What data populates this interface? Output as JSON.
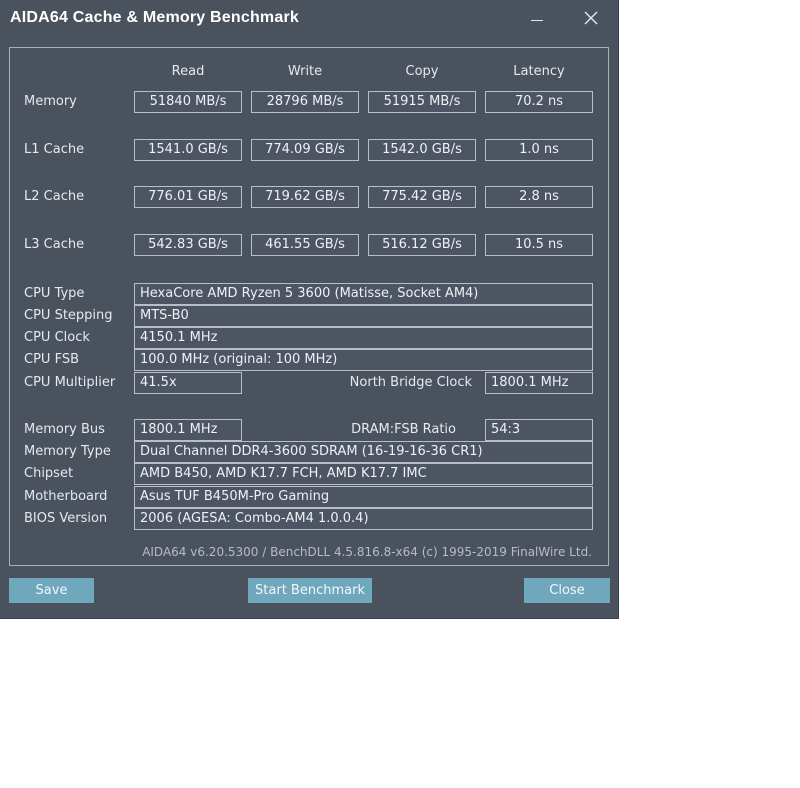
{
  "window": {
    "title": "AIDA64 Cache & Memory Benchmark"
  },
  "columns": [
    "Read",
    "Write",
    "Copy",
    "Latency"
  ],
  "bench_rows": [
    {
      "label": "Memory",
      "values": [
        "51840 MB/s",
        "28796 MB/s",
        "51915 MB/s",
        "70.2 ns"
      ]
    },
    {
      "label": "L1 Cache",
      "values": [
        "1541.0 GB/s",
        "774.09 GB/s",
        "1542.0 GB/s",
        "1.0 ns"
      ]
    },
    {
      "label": "L2 Cache",
      "values": [
        "776.01 GB/s",
        "719.62 GB/s",
        "775.42 GB/s",
        "2.8 ns"
      ]
    },
    {
      "label": "L3 Cache",
      "values": [
        "542.83 GB/s",
        "461.55 GB/s",
        "516.12 GB/s",
        "10.5 ns"
      ]
    }
  ],
  "cpu": {
    "type_label": "CPU Type",
    "type": "HexaCore AMD Ryzen 5 3600  (Matisse, Socket AM4)",
    "stepping_label": "CPU Stepping",
    "stepping": "MTS-B0",
    "clock_label": "CPU Clock",
    "clock": "4150.1 MHz",
    "fsb_label": "CPU FSB",
    "fsb": "100.0 MHz  (original: 100 MHz)",
    "multiplier_label": "CPU Multiplier",
    "multiplier": "41.5x",
    "nb_clock_label": "North Bridge Clock",
    "nb_clock": "1800.1 MHz"
  },
  "memory": {
    "bus_label": "Memory Bus",
    "bus": "1800.1 MHz",
    "ratio_label": "DRAM:FSB Ratio",
    "ratio": "54:3",
    "type_label": "Memory Type",
    "type": "Dual Channel DDR4-3600 SDRAM  (16-19-16-36 CR1)",
    "chipset_label": "Chipset",
    "chipset": "AMD B450, AMD K17.7 FCH, AMD K17.7 IMC",
    "motherboard_label": "Motherboard",
    "motherboard": "Asus TUF B450M-Pro Gaming",
    "bios_label": "BIOS Version",
    "bios": "2006  (AGESA: Combo-AM4 1.0.0.4)"
  },
  "footer": "AIDA64 v6.20.5300 / BenchDLL 4.5.816.8-x64  (c) 1995-2019 FinalWire Ltd.",
  "buttons": {
    "save": "Save",
    "start": "Start Benchmark",
    "close": "Close"
  }
}
